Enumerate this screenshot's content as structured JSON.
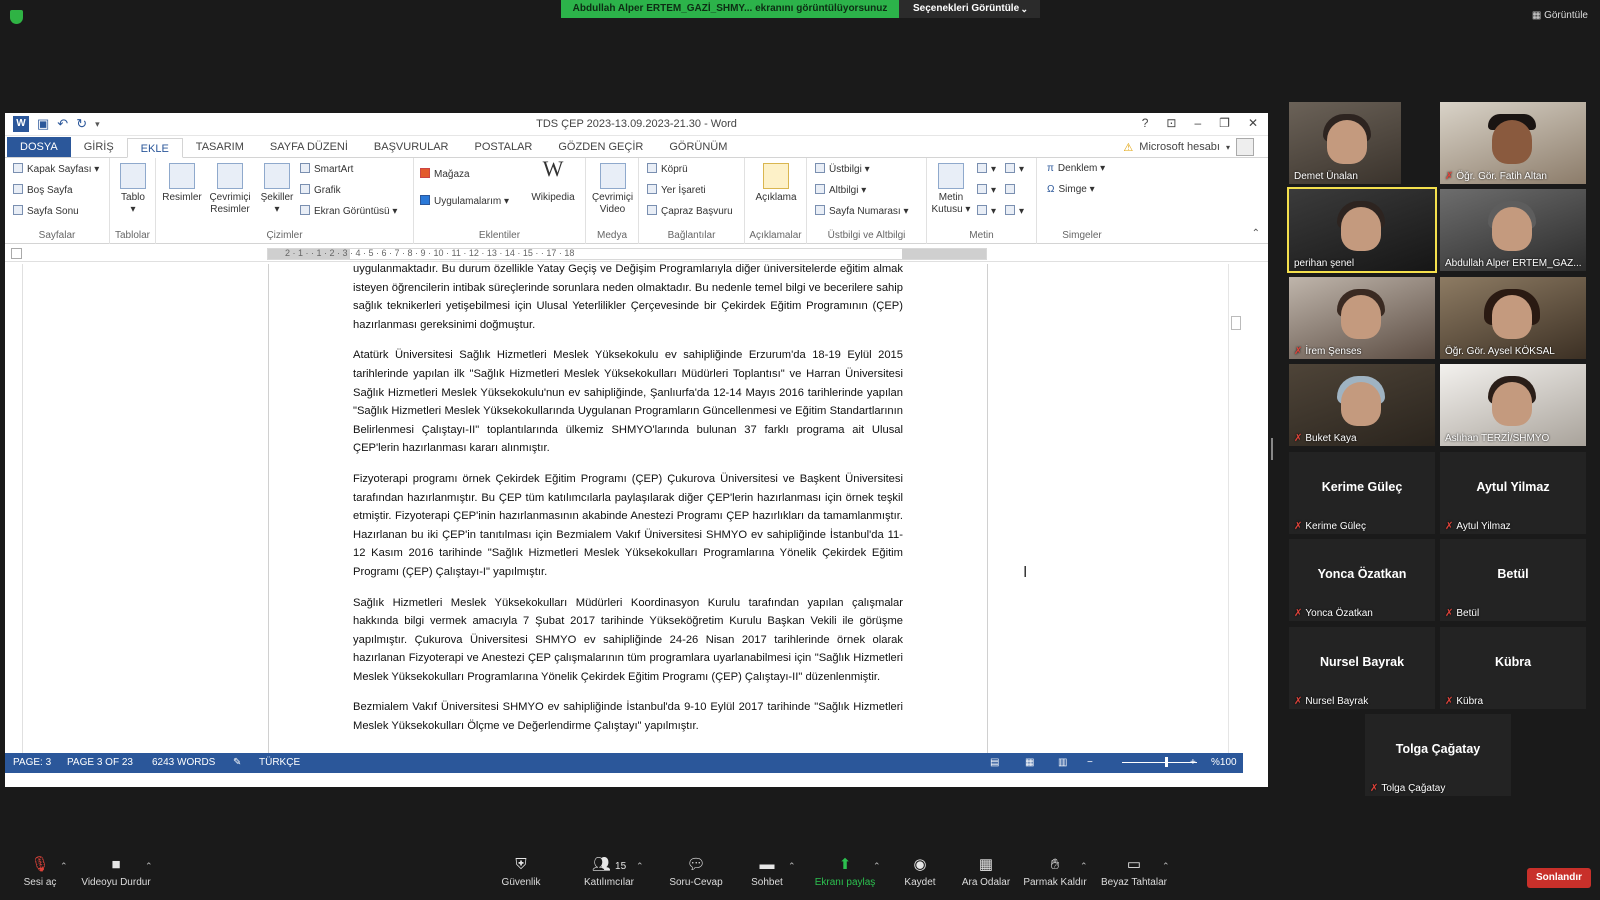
{
  "meeting": {
    "share_banner": "Abdullah Alper ERTEM_GAZİ_SHMY... ekranını görüntülüyorsunuz",
    "view_options": "Seçenekleri Görüntüle",
    "view_button": "Görüntüle"
  },
  "word": {
    "title": "TDS ÇEP 2023-13.09.2023-21.30 - Word",
    "account": "Microsoft hesabı",
    "tabs": [
      "DOSYA",
      "GİRİŞ",
      "EKLE",
      "TASARIM",
      "SAYFA DÜZENİ",
      "BAŞVURULAR",
      "POSTALAR",
      "GÖZDEN GEÇİR",
      "GÖRÜNÜM"
    ],
    "ribbon": {
      "sayfalar": {
        "label": "Sayfalar",
        "items": [
          "Kapak Sayfası",
          "Boş Sayfa",
          "Sayfa Sonu"
        ]
      },
      "tablolar": {
        "label": "Tablolar",
        "items": [
          "Tablo"
        ]
      },
      "cizimler": {
        "label": "Çizimler",
        "items": [
          "Resimler",
          "Çevrimiçi Resimler",
          "Şekiller",
          "SmartArt",
          "Grafik",
          "Ekran Görüntüsü"
        ]
      },
      "eklentiler": {
        "label": "Eklentiler",
        "items": [
          "Mağaza",
          "Uygulamalarım",
          "Wikipedia"
        ]
      },
      "medya": {
        "label": "Medya",
        "items": [
          "Çevrimiçi Video"
        ]
      },
      "baglantilar": {
        "label": "Bağlantılar",
        "items": [
          "Köprü",
          "Yer İşareti",
          "Çapraz Başvuru"
        ]
      },
      "aciklamalar": {
        "label": "Açıklamalar",
        "items": [
          "Açıklama"
        ]
      },
      "ustbilgi": {
        "label": "Üstbilgi ve Altbilgi",
        "items": [
          "Üstbilgi",
          "Altbilgi",
          "Sayfa Numarası"
        ]
      },
      "metin": {
        "label": "Metin",
        "items": [
          "Metin Kutusu"
        ]
      },
      "simgeler": {
        "label": "Simgeler",
        "items": [
          "Denklem",
          "Simge"
        ]
      }
    },
    "ruler_numbers": "2 · 1 · · 1 · 2 · 3 · 4 · 5 · 6 · 7 · 8 · 9 · 10 · 11 · 12 · 13 · 14 · 15 · · 17 · 18",
    "paragraphs": [
      "uygulanmaktadır. Bu durum özellikle Yatay Geçiş ve Değişim Programlarıyla diğer üniversitelerde eğitim almak isteyen öğrencilerin intibak süreçlerinde sorunlara neden olmaktadır. Bu nedenle temel bilgi ve becerilere sahip sağlık teknikerleri yetişebilmesi için Ulusal Yeterlilikler Çerçevesinde bir Çekirdek Eğitim Programının (ÇEP) hazırlanması gereksinimi doğmuştur.",
      "Atatürk Üniversitesi Sağlık Hizmetleri Meslek Yüksekokulu ev sahipliğinde Erzurum'da 18-19 Eylül 2015 tarihlerinde yapılan ilk \"Sağlık Hizmetleri Meslek Yüksekokulları Müdürleri Toplantısı\" ve Harran Üniversitesi Sağlık Hizmetleri Meslek Yüksekokulu'nun ev sahipliğinde, Şanlıurfa'da 12-14 Mayıs 2016 tarihlerinde yapılan \"Sağlık Hizmetleri Meslek Yüksekokullarında Uygulanan Programların Güncellenmesi ve Eğitim Standartlarının Belirlenmesi Çalıştayı-II\" toplantılarında ülkemiz SHMYO'larında bulunan 37 farklı programa ait Ulusal ÇEP'lerin hazırlanması kararı alınmıştır.",
      "Fizyoterapi programı örnek Çekirdek Eğitim Programı (ÇEP) Çukurova Üniversitesi ve Başkent Üniversitesi tarafından hazırlanmıştır. Bu ÇEP tüm katılımcılarla paylaşılarak diğer ÇEP'lerin hazırlanması için örnek teşkil etmiştir. Fizyoterapi ÇEP'inin hazırlanmasının akabinde Anestezi Programı ÇEP hazırlıkları da tamamlanmıştır. Hazırlanan bu iki ÇEP'in tanıtılması için Bezmialem Vakıf Üniversitesi SHMYO ev sahipliğinde İstanbul'da 11-12 Kasım 2016 tarihinde \"Sağlık Hizmetleri Meslek Yüksekokulları Programlarına Yönelik Çekirdek Eğitim Programı (ÇEP) Çalıştayı-I\" yapılmıştır.",
      "Sağlık Hizmetleri Meslek Yüksekokulları Müdürleri Koordinasyon Kurulu tarafından yapılan çalışmalar hakkında bilgi vermek amacıyla 7 Şubat 2017 tarihinde Yükseköğretim Kurulu Başkan Vekili ile görüşme yapılmıştır. Çukurova Üniversitesi SHMYO ev sahipliğinde 24-26 Nisan 2017 tarihlerinde örnek olarak hazırlanan Fizyoterapi ve Anestezi ÇEP çalışmalarının tüm programlara uyarlanabilmesi için \"Sağlık Hizmetleri Meslek Yüksekokulları Programlarına Yönelik Çekirdek Eğitim Programı (ÇEP) Çalıştayı-II\" düzenlenmiştir.",
      "Bezmialem Vakıf Üniversitesi SHMYO ev sahipliğinde İstanbul'da 9-10 Eylül 2017 tarihinde \"Sağlık Hizmetleri Meslek Yüksekokulları Ölçme ve Değerlendirme Çalıştayı\" yapılmıştır."
    ],
    "status": {
      "page": "PAGE: 3",
      "page_of": "PAGE 3 OF 23",
      "words": "6243 WORDS",
      "language": "TÜRKÇE",
      "zoom": "%100"
    }
  },
  "participants": [
    {
      "name": "Demet Ünalan",
      "muted": false,
      "video": true
    },
    {
      "name": "Öğr. Gör. Fatih Altan",
      "muted": true,
      "video": true
    },
    {
      "name": "perihan şenel",
      "muted": false,
      "video": true,
      "speaking": true
    },
    {
      "name": "Abdullah Alper ERTEM_GAZ...",
      "muted": false,
      "video": true
    },
    {
      "name": "İrem Şenses",
      "muted": true,
      "video": true
    },
    {
      "name": "Öğr. Gör. Aysel KÖKSAL",
      "muted": false,
      "video": true
    },
    {
      "name": "Buket Kaya",
      "muted": true,
      "video": true
    },
    {
      "name": "Aslıhan TERZİ/SHMYO",
      "muted": false,
      "video": true
    },
    {
      "name": "Kerime Güleç",
      "muted": true,
      "video": false
    },
    {
      "name": "Aytul Yilmaz",
      "muted": true,
      "video": false
    },
    {
      "name": "Yonca Özatkan",
      "muted": true,
      "video": false
    },
    {
      "name": "Betül",
      "muted": true,
      "video": false
    },
    {
      "name": "Nursel Bayrak",
      "muted": true,
      "video": false
    },
    {
      "name": "Kübra",
      "muted": true,
      "video": false
    },
    {
      "name": "Tolga Çağatay",
      "muted": true,
      "video": false
    }
  ],
  "toolbar": {
    "mute": "Sesi aç",
    "video": "Videoyu Durdur",
    "security": "Güvenlik",
    "participants": "Katılımcılar",
    "participants_count": "15",
    "qa": "Soru-Cevap",
    "chat": "Sohbet",
    "share": "Ekranı paylaş",
    "record": "Kaydet",
    "breakout": "Ara Odalar",
    "raise_hand": "Parmak Kaldır",
    "whiteboard": "Beyaz Tahtalar",
    "end": "Sonlandır"
  }
}
